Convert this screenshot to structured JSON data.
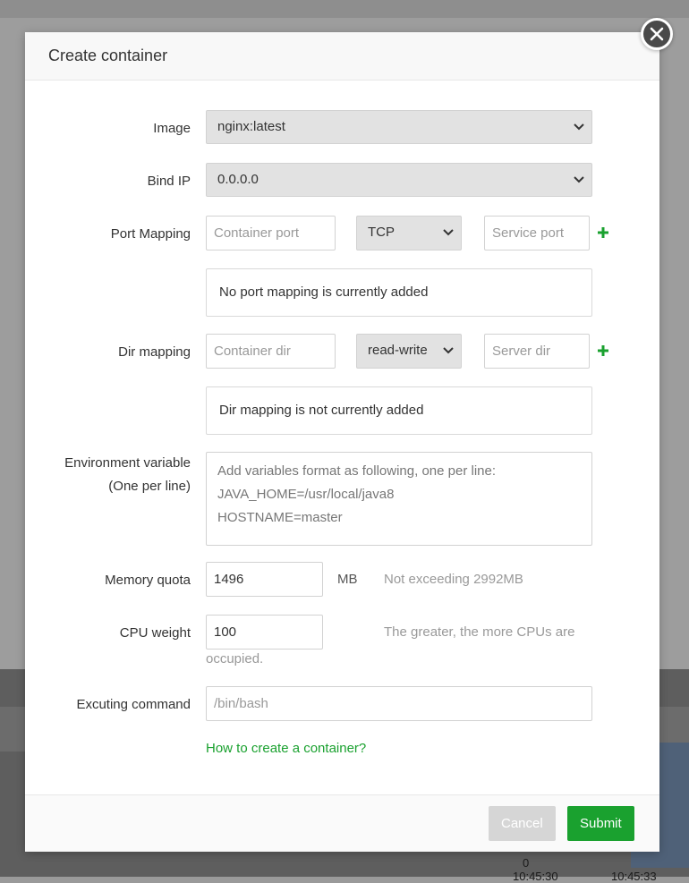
{
  "modal": {
    "title": "Create container",
    "close_icon": "close-icon"
  },
  "form": {
    "image": {
      "label": "Image",
      "selected": "nginx:latest"
    },
    "bind_ip": {
      "label": "Bind IP",
      "selected": "0.0.0.0"
    },
    "port_mapping": {
      "label": "Port Mapping",
      "container_port_placeholder": "Container port",
      "protocol_selected": "TCP",
      "service_port_placeholder": "Service port",
      "empty_text": "No port mapping is currently added"
    },
    "dir_mapping": {
      "label": "Dir mapping",
      "container_dir_placeholder": "Container dir",
      "mode_selected": "read-write",
      "server_dir_placeholder": "Server dir",
      "empty_text": "Dir mapping is not currently added"
    },
    "env": {
      "label_line1": "Environment variable",
      "label_line2": "(One per line)",
      "placeholder_lines": [
        "Add variables format as following, one per line:",
        "JAVA_HOME=/usr/local/java8",
        "HOSTNAME=master"
      ]
    },
    "memory": {
      "label": "Memory quota",
      "value": "1496",
      "unit": "MB",
      "hint": "Not exceeding 2992MB"
    },
    "cpu": {
      "label": "CPU weight",
      "value": "100",
      "hint_line1": "The greater, the more CPUs are",
      "hint_line2": "occupied."
    },
    "command": {
      "label": "Excuting command",
      "placeholder": "/bin/bash"
    },
    "help_link": "How to create a container?"
  },
  "footer": {
    "cancel_label": "Cancel",
    "submit_label": "Submit"
  },
  "background": {
    "axis_zero": "0",
    "axis_tick_1": "10:45:30",
    "axis_tick_2": "10:45:33"
  },
  "colors": {
    "accent": "#1aa12f",
    "select_bg": "#e2e2e2",
    "overlay": "#9a9a9a"
  }
}
